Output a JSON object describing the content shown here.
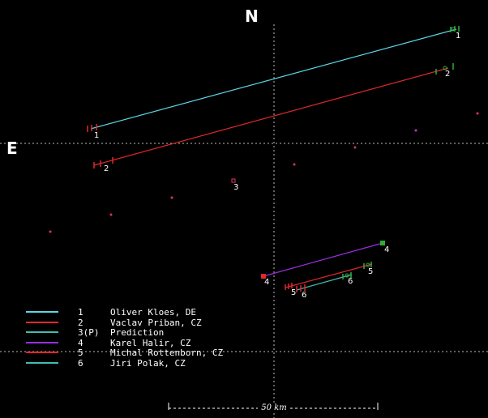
{
  "compass": {
    "north": "N",
    "east": "E"
  },
  "colors": {
    "cyan": "#5cd6e6",
    "red": "#e0282a",
    "teal": "#3fbfae",
    "purple": "#9a2ee0",
    "green": "#2fae3a",
    "background": "#000000",
    "grid": "#bbbbbb",
    "star": "#e0306a"
  },
  "tracks": [
    {
      "id": "1",
      "label": "1",
      "color": "#5cd6e6"
    },
    {
      "id": "2",
      "label": "2",
      "color": "#e0282a"
    },
    {
      "id": "3",
      "label": "3",
      "color": "#3fbfae"
    },
    {
      "id": "4",
      "label": "4",
      "color": "#9a2ee0"
    },
    {
      "id": "5",
      "label": "5",
      "color": "#e0282a"
    },
    {
      "id": "6",
      "label": "6",
      "color": "#3fbfae"
    }
  ],
  "legend": [
    {
      "num": "1",
      "name": "Oliver Kloes, DE",
      "color": "#5cd6e6"
    },
    {
      "num": "2",
      "name": "Vaclav Priban, CZ",
      "color": "#e0282a"
    },
    {
      "num": "3(P)",
      "name": "Prediction",
      "color": "#3fbfae"
    },
    {
      "num": "4",
      "name": "Karel Halir, CZ",
      "color": "#9a2ee0"
    },
    {
      "num": "5",
      "name": "Michal Rottenborn, CZ",
      "color": "#e0282a"
    },
    {
      "num": "6",
      "name": "Jiri Polak, CZ",
      "color": "#3fbfae"
    }
  ],
  "scale": {
    "label": "50 km"
  }
}
